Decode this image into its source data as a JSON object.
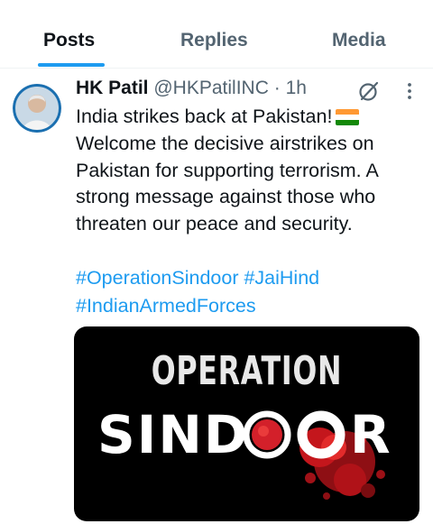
{
  "tabs": [
    {
      "label": "Posts",
      "active": true
    },
    {
      "label": "Replies",
      "active": false
    },
    {
      "label": "Media",
      "active": false
    }
  ],
  "post": {
    "author_name": "HK Patil",
    "handle": "@HKPatilINC",
    "separator": "·",
    "time": "1h",
    "lines": [
      "India strikes back at Pakistan!",
      "Welcome the decisive airstrikes on",
      "Pakistan for supporting terrorism. A",
      "strong message against those who",
      "threaten our peace and security."
    ],
    "hashtags": [
      "#OperationSindoor",
      "#JaiHind",
      "#IndianArmedForces"
    ],
    "media": {
      "line1": "OPERATION",
      "line2_part1": "SIND",
      "line2_part2": "R"
    }
  },
  "icons": {
    "grok": "grok-icon",
    "more": "more-icon",
    "flag": "india-flag-icon"
  },
  "colors": {
    "accent": "#1d9bf0",
    "text": "#0f1419",
    "muted": "#536471",
    "splash_red": "#c4161c"
  }
}
